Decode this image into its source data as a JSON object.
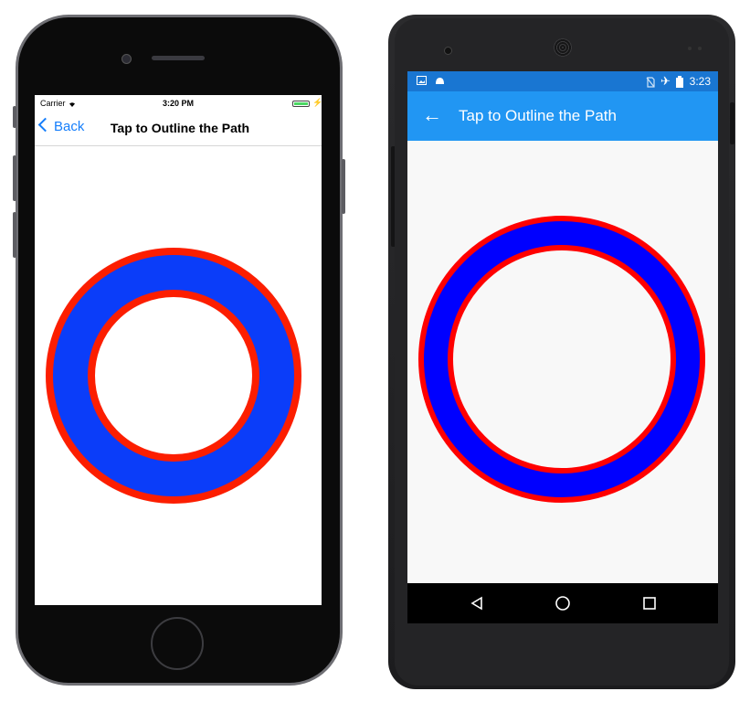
{
  "ios": {
    "status": {
      "carrier": "Carrier",
      "time": "3:20 PM"
    },
    "nav": {
      "back_label": "Back",
      "title": "Tap to Outline the Path"
    },
    "colors": {
      "fill": "#0b3df9",
      "stroke": "#fc1e00",
      "accent": "#157efb"
    }
  },
  "android": {
    "status": {
      "time": "3:23"
    },
    "appbar": {
      "title": "Tap to Outline the Path"
    },
    "colors": {
      "fill": "#0000ff",
      "stroke": "#ff0000",
      "appbar": "#2196f3",
      "statusbar": "#1976d2"
    }
  }
}
